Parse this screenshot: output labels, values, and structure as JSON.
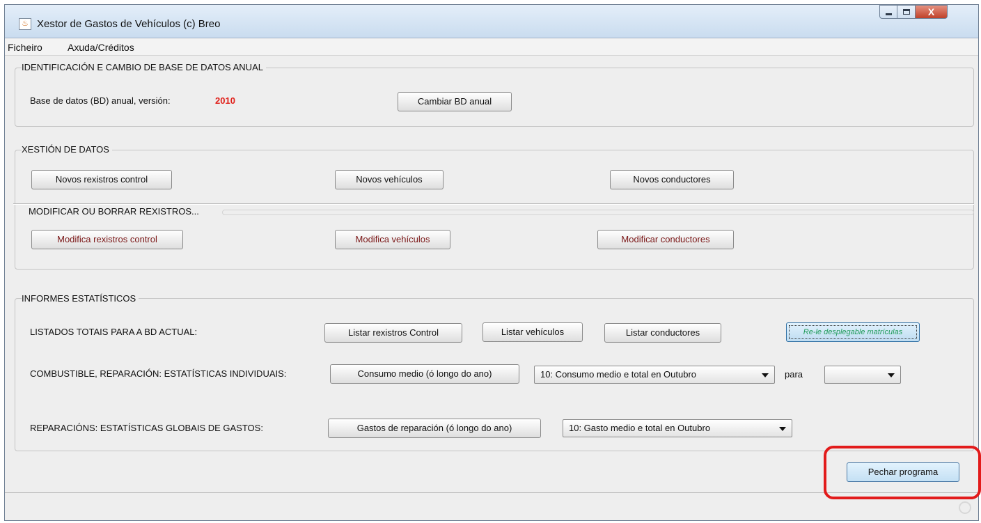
{
  "window": {
    "title": "Xestor de Gastos de Vehículos (c) Breo",
    "icon": "java-cup-icon",
    "close_glyph": "X"
  },
  "menu": [
    "Ficheiro",
    "Axuda/Créditos"
  ],
  "section_db": {
    "title": "IDENTIFICACIÓN E CAMBIO DE BASE DE DATOS ANUAL",
    "label": "Base de datos (BD) anual, versión:",
    "version": "2010",
    "version_color": "#e0201a",
    "change_button": "Cambiar BD anual"
  },
  "section_data": {
    "title": "XESTIÓN DE DATOS",
    "new_buttons": [
      "Novos rexistros control",
      "Novos vehículos",
      "Novos conductores"
    ],
    "modify_title": "MODIFICAR OU BORRAR REXISTROS...",
    "modify_buttons": [
      "Modifica rexistros control",
      "Modifica vehículos",
      "Modificar conductores"
    ]
  },
  "section_reports": {
    "title": "INFORMES ESTATÍSTICOS",
    "totals_label": "LISTADOS TOTAIS PARA A BD ACTUAL:",
    "list_buttons": [
      "Listar rexistros Control",
      "Listar vehículos",
      "Listar conductores"
    ],
    "reload_button": "Re-le desplegable matrículas",
    "individual_label": "COMBUSTIBLE, REPARACIÓN: ESTATÍSTICAS INDIVIDUAIS:",
    "consumption_button": "Consumo medio (ó longo do ano)",
    "consumption_select": "10: Consumo medio e total en Outubro",
    "para_label": "para",
    "plate_select": "",
    "global_label": "REPARACIÓNS: ESTATÍSTICAS GLOBAIS DE GASTOS:",
    "repair_button": "Gastos de reparación (ó longo do ano)",
    "repair_select": "10: Gasto medio e total en Outubro"
  },
  "close_program_button": "Pechar programa",
  "highlight_color": "#e21b1b"
}
